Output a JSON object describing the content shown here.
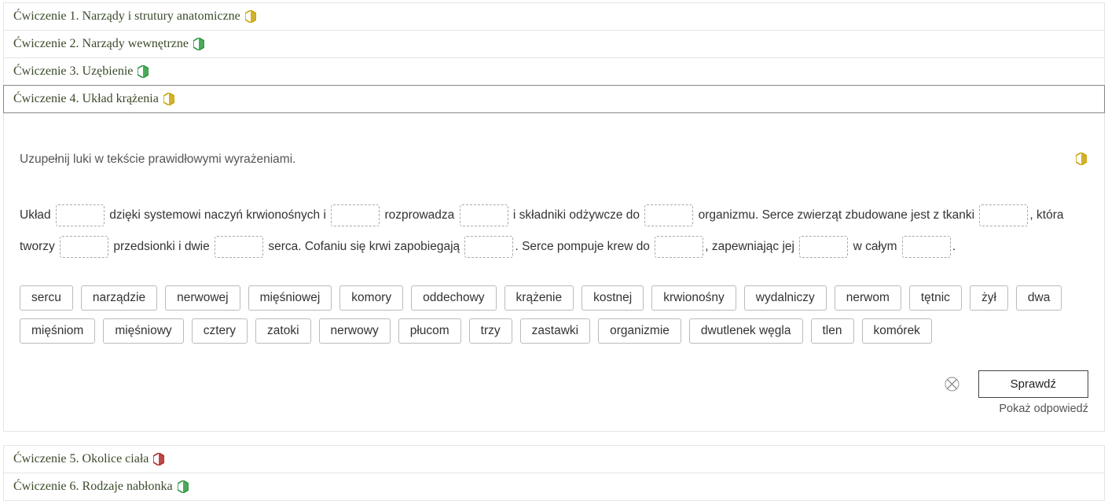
{
  "exercises": [
    {
      "label": "Ćwiczenie 1. Narządy i strutury anatomiczne",
      "icon": "yellow"
    },
    {
      "label": "Ćwiczenie 2. Narządy wewnętrzne",
      "icon": "green"
    },
    {
      "label": "Ćwiczenie 3. Uzębienie",
      "icon": "green"
    },
    {
      "label": "Ćwiczenie 4. Układ krążenia",
      "icon": "yellow"
    },
    {
      "label": "Ćwiczenie 5. Okolice ciała",
      "icon": "red"
    },
    {
      "label": "Ćwiczenie 6. Rodzaje nabłonka",
      "icon": "green"
    }
  ],
  "active_exercise_index": 3,
  "body": {
    "top_icon": "yellow",
    "instruction": "Uzupełnij luki w tekście prawidłowymi wyrażeniami.",
    "text_parts": [
      "Układ ",
      "GAP",
      " dzięki systemowi naczyń krwionośnych i ",
      "GAP",
      " rozprowadza ",
      "GAP",
      " i składniki odżywcze do ",
      "GAP",
      " organizmu. Serce zwierząt zbudowane jest z tkanki ",
      "GAP",
      ", która tworzy ",
      "GAP",
      " przedsionki i dwie ",
      "GAP",
      " serca. Cofaniu się krwi zapobiegają ",
      "GAP",
      ". Serce pompuje krew do ",
      "GAP",
      ", zapewniając jej ",
      "GAP",
      " w całym ",
      "GAP",
      "."
    ],
    "words": [
      "sercu",
      "narządzie",
      "nerwowej",
      "mięśniowej",
      "komory",
      "oddechowy",
      "krążenie",
      "kostnej",
      "krwionośny",
      "wydalniczy",
      "nerwom",
      "tętnic",
      "żył",
      "dwa",
      "mięśniom",
      "mięśniowy",
      "cztery",
      "zatoki",
      "nerwowy",
      "płucom",
      "trzy",
      "zastawki",
      "organizmie",
      "dwutlenek węgla",
      "tlen",
      "komórek"
    ],
    "check_label": "Sprawdź",
    "show_answer_label": "Pokaż odpowiedź"
  },
  "icon_colors": {
    "yellow": "#c9a509",
    "green": "#2b9a3e",
    "red": "#b22a2a"
  }
}
